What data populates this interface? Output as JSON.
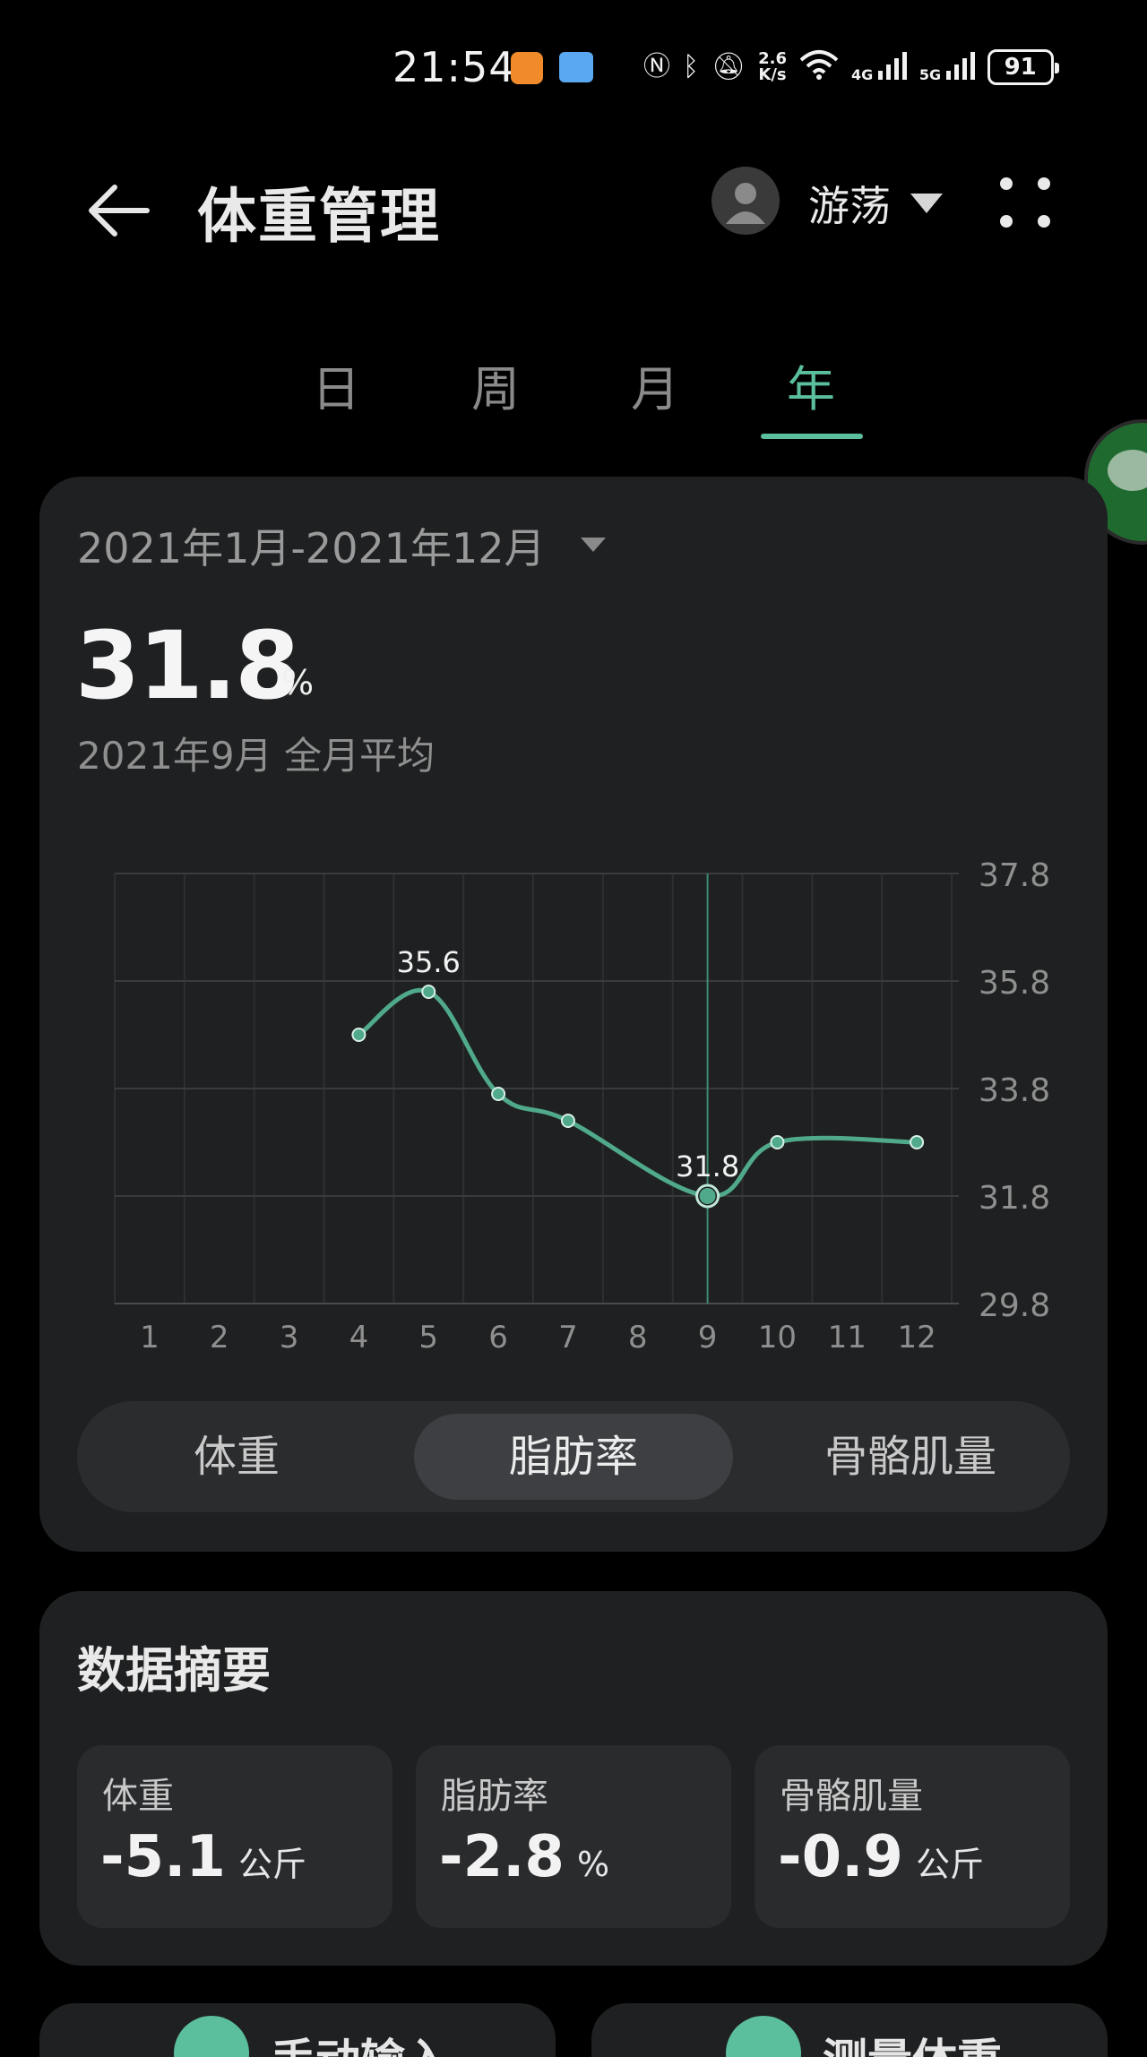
{
  "status_bar": {
    "time": "21:54",
    "net_speed_value": "2.6",
    "net_speed_unit": "K/s",
    "net_4g": "4G",
    "net_5g": "5G",
    "battery": "91",
    "icons": [
      "nfc-icon",
      "bluetooth-icon",
      "mute-icon",
      "wifi-icon",
      "signal-4g-icon",
      "signal-5g-icon",
      "battery-icon"
    ]
  },
  "header": {
    "title": "体重管理",
    "user_name": "游荡"
  },
  "tabs": [
    {
      "label": "日",
      "active": false
    },
    {
      "label": "周",
      "active": false
    },
    {
      "label": "月",
      "active": false
    },
    {
      "label": "年",
      "active": true
    }
  ],
  "chart_card": {
    "range": "2021年1月-2021年12月",
    "value": "31.8",
    "unit": "%",
    "sub_label": "2021年9月  全月平均"
  },
  "chart_data": {
    "type": "line",
    "x": [
      1,
      2,
      3,
      4,
      5,
      6,
      7,
      8,
      9,
      10,
      11,
      12
    ],
    "x_tick_labels": [
      "1",
      "2",
      "3",
      "4",
      "5",
      "6",
      "7",
      "8",
      "9",
      "10",
      "11",
      "12"
    ],
    "y_tick_labels": [
      "37.8",
      "35.8",
      "33.8",
      "31.8",
      "29.8"
    ],
    "ylim": [
      29.8,
      37.8
    ],
    "points": [
      {
        "x": 4,
        "y": 34.8
      },
      {
        "x": 5,
        "y": 35.6,
        "label": "35.6"
      },
      {
        "x": 6,
        "y": 33.7
      },
      {
        "x": 7,
        "y": 33.2
      },
      {
        "x": 9,
        "y": 31.8,
        "label": "31.8",
        "selected": true
      },
      {
        "x": 10,
        "y": 32.8
      },
      {
        "x": 12,
        "y": 32.8
      }
    ],
    "line_color": "#4fa98a",
    "grid": true,
    "y_axis_position": "right"
  },
  "metric_toggle": [
    {
      "label": "体重",
      "active": false
    },
    {
      "label": "脂肪率",
      "active": true
    },
    {
      "label": "骨骼肌量",
      "active": false
    }
  ],
  "summary": {
    "title": "数据摘要",
    "stats": [
      {
        "label": "体重",
        "value": "-5.1",
        "unit": "公斤"
      },
      {
        "label": "脂肪率",
        "value": "-2.8",
        "unit": "%"
      },
      {
        "label": "骨骼肌量",
        "value": "-0.9",
        "unit": "公斤"
      }
    ]
  },
  "bottom_actions": [
    {
      "label": "手动输入"
    },
    {
      "label": "测量体重"
    }
  ]
}
